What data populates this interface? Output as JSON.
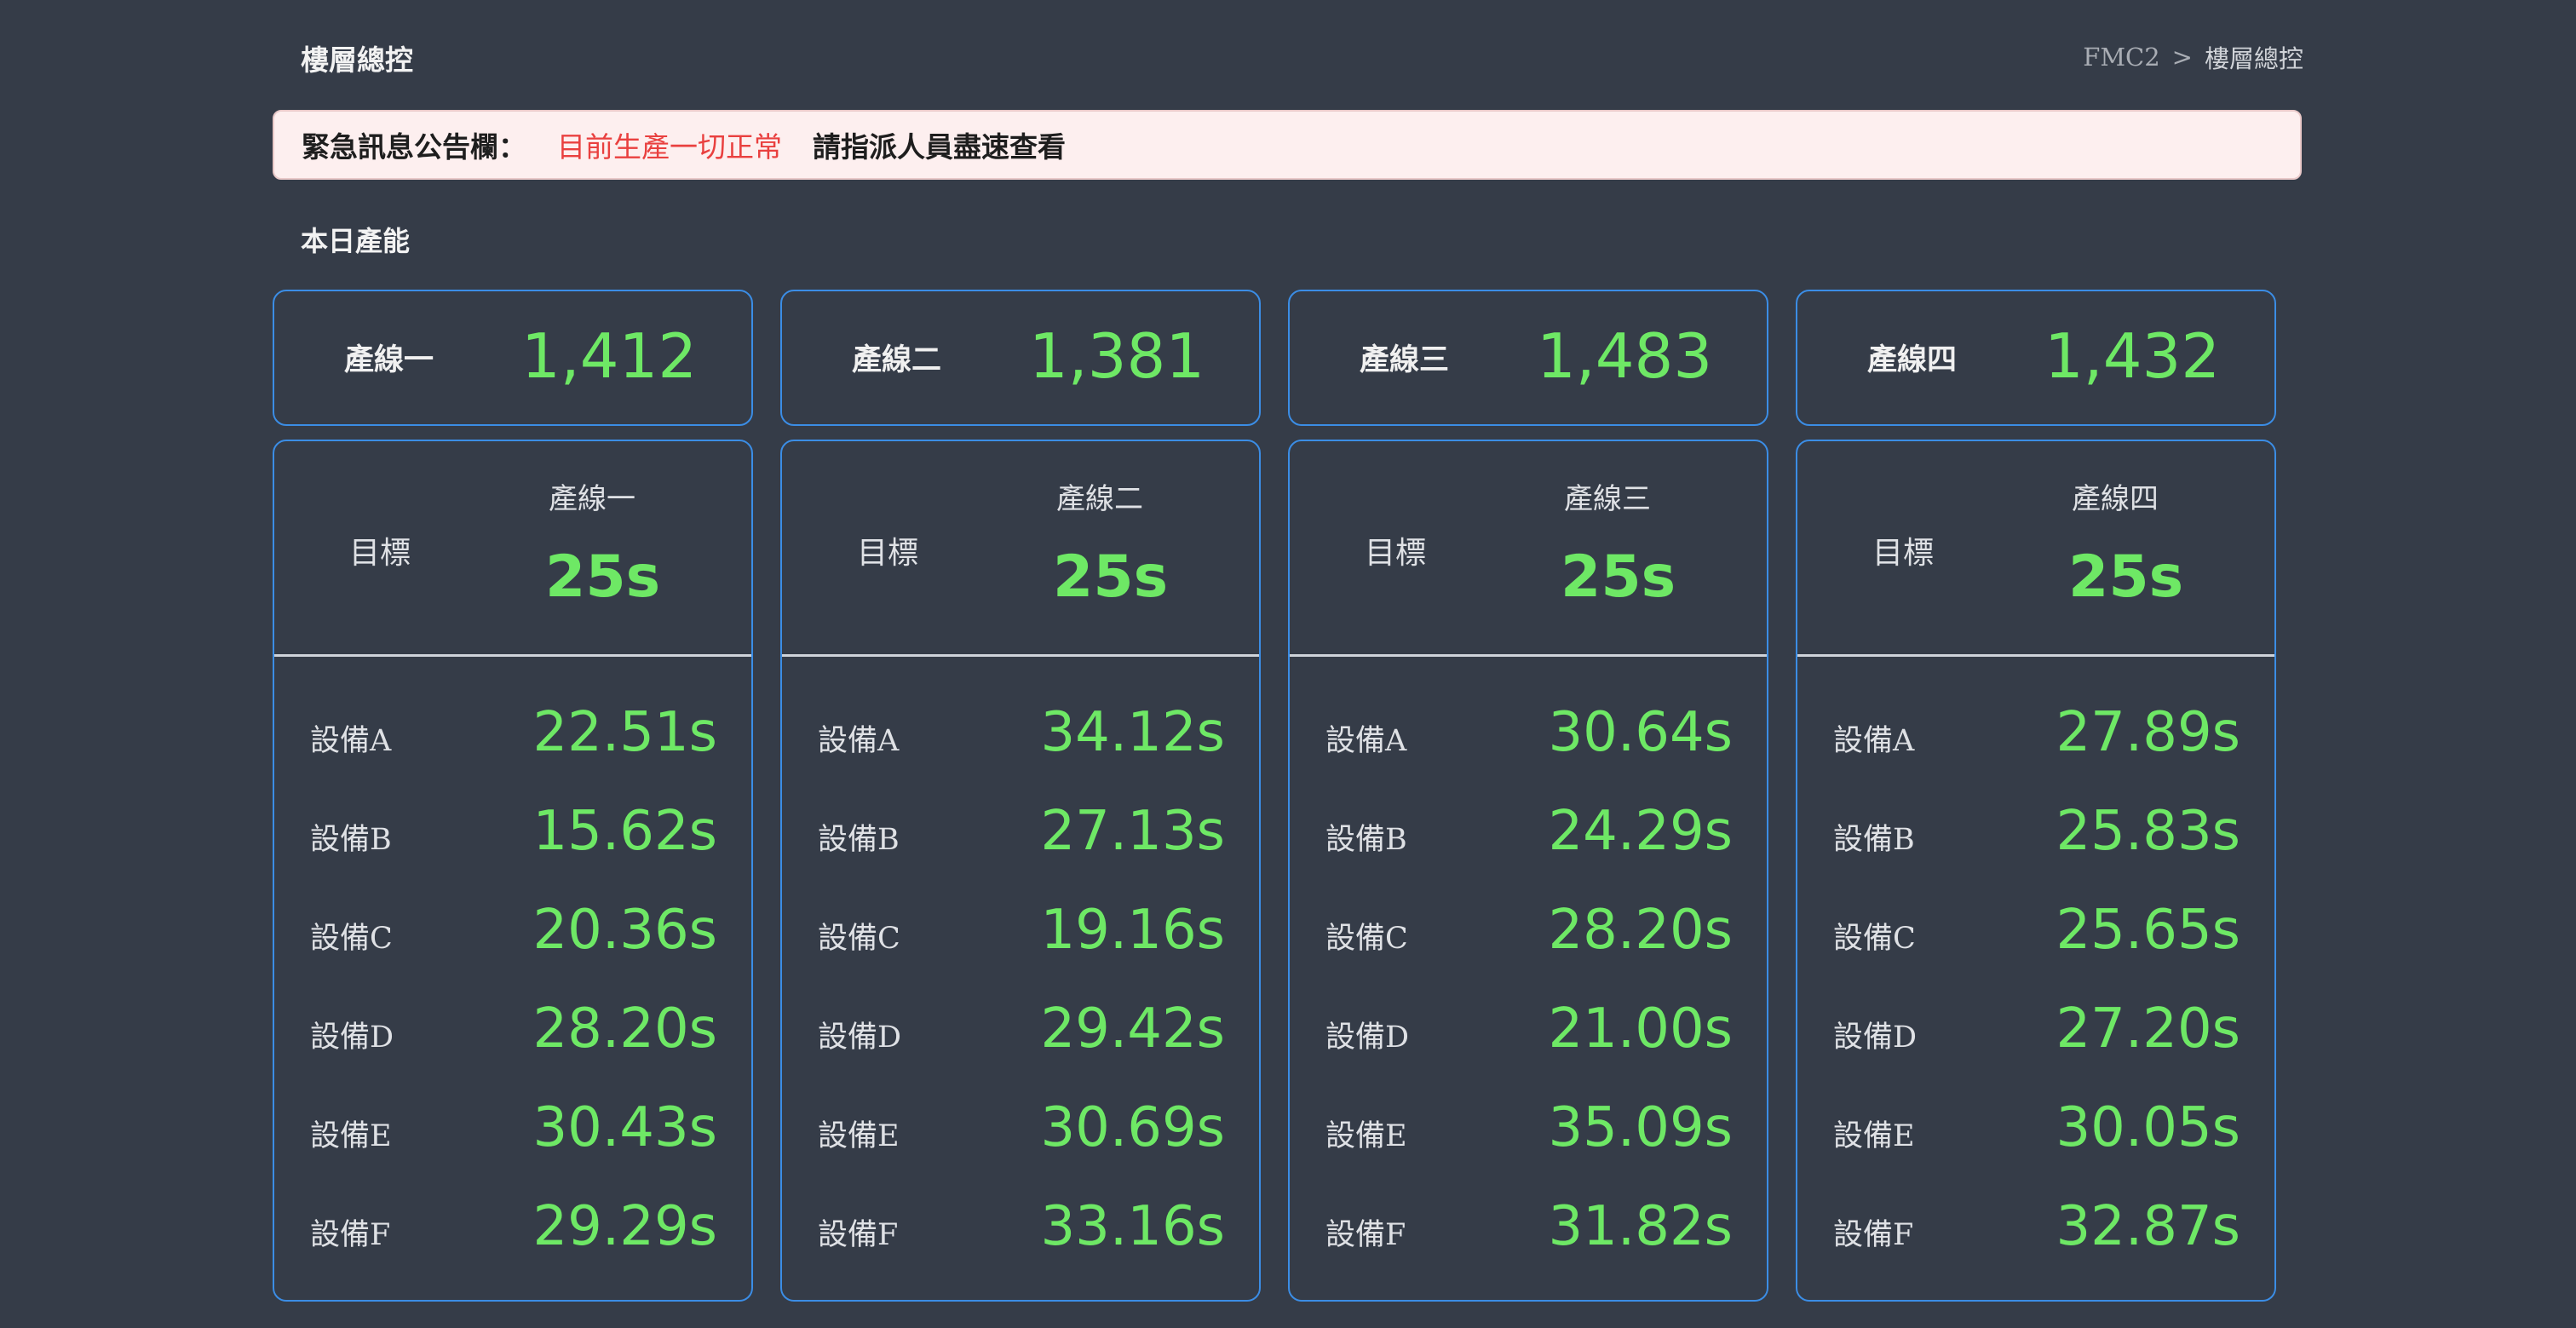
{
  "header": {
    "title": "樓層總控",
    "breadcrumb": [
      "FMC2",
      ">",
      "樓層總控"
    ]
  },
  "announcement": {
    "label": "緊急訊息公告欄：",
    "status": "目前生產一切正常",
    "action": "請指派人員盡速查看"
  },
  "section": {
    "title": "本日產能"
  },
  "production": [
    {
      "name": "產線一",
      "value": "1,412"
    },
    {
      "name": "產線二",
      "value": "1,381"
    },
    {
      "name": "產線三",
      "value": "1,483"
    },
    {
      "name": "產線四",
      "value": "1,432"
    }
  ],
  "lines": [
    {
      "target_label": "目標",
      "name": "產線一",
      "target": "25s",
      "equipment": [
        {
          "name": "設備A",
          "value": "22.51s"
        },
        {
          "name": "設備B",
          "value": "15.62s"
        },
        {
          "name": "設備C",
          "value": "20.36s"
        },
        {
          "name": "設備D",
          "value": "28.20s"
        },
        {
          "name": "設備E",
          "value": "30.43s"
        },
        {
          "name": "設備F",
          "value": "29.29s"
        }
      ]
    },
    {
      "target_label": "目標",
      "name": "產線二",
      "target": "25s",
      "equipment": [
        {
          "name": "設備A",
          "value": "34.12s"
        },
        {
          "name": "設備B",
          "value": "27.13s"
        },
        {
          "name": "設備C",
          "value": "19.16s"
        },
        {
          "name": "設備D",
          "value": "29.42s"
        },
        {
          "name": "設備E",
          "value": "30.69s"
        },
        {
          "name": "設備F",
          "value": "33.16s"
        }
      ]
    },
    {
      "target_label": "目標",
      "name": "產線三",
      "target": "25s",
      "equipment": [
        {
          "name": "設備A",
          "value": "30.64s"
        },
        {
          "name": "設備B",
          "value": "24.29s"
        },
        {
          "name": "設備C",
          "value": "28.20s"
        },
        {
          "name": "設備D",
          "value": "21.00s"
        },
        {
          "name": "設備E",
          "value": "35.09s"
        },
        {
          "name": "設備F",
          "value": "31.82s"
        }
      ]
    },
    {
      "target_label": "目標",
      "name": "產線四",
      "target": "25s",
      "equipment": [
        {
          "name": "設備A",
          "value": "27.89s"
        },
        {
          "name": "設備B",
          "value": "25.83s"
        },
        {
          "name": "設備C",
          "value": "25.65s"
        },
        {
          "name": "設備D",
          "value": "27.20s"
        },
        {
          "name": "設備E",
          "value": "30.05s"
        },
        {
          "name": "設備F",
          "value": "32.87s"
        }
      ]
    }
  ],
  "colors": {
    "background": "#353c48",
    "accent_border": "#3b8de5",
    "value_green": "#6ee865",
    "alert_red": "#e9403f",
    "announce_bg": "#fdefef"
  }
}
